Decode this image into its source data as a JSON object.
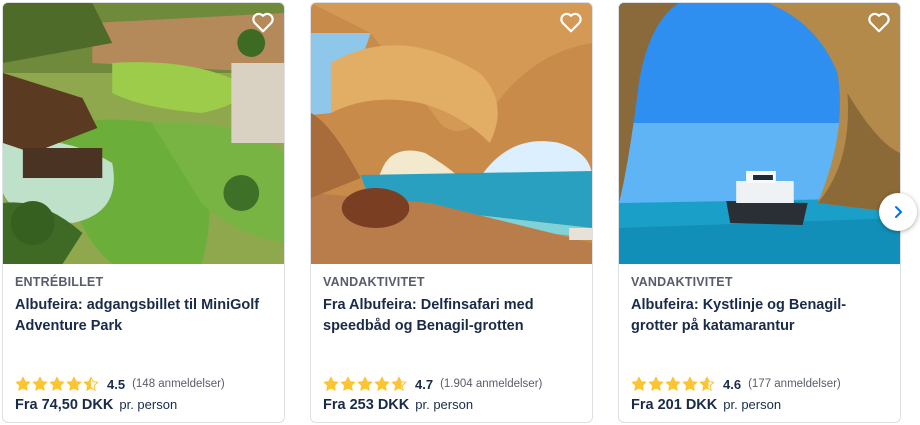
{
  "cards": [
    {
      "category": "ENTRÉBILLET",
      "title": "Albufeira: adgangsbillet til MiniGolf Adventure Park",
      "score": "4.5",
      "reviews": "(148 anmeldelser)",
      "rating_value": 4.5,
      "price_amount": "Fra 74,50 DKK",
      "price_unit": "pr. person"
    },
    {
      "category": "VANDAKTIVITET",
      "title": "Fra Albufeira: Delfinsafari med speedbåd og Benagil-grotten",
      "score": "4.7",
      "reviews": "(1.904 anmeldelser)",
      "rating_value": 4.7,
      "price_amount": "Fra 253 DKK",
      "price_unit": "pr. person"
    },
    {
      "category": "VANDAKTIVITET",
      "title": "Albufeira: Kystlinje og Benagil-grotter på katamarantur",
      "score": "4.6",
      "reviews": "(177 anmeldelser)",
      "rating_value": 4.6,
      "price_amount": "Fra 201 DKK",
      "price_unit": "pr. person"
    }
  ],
  "colors": {
    "star": "#fdc433",
    "text": "#1a2b49",
    "muted": "#585d6b",
    "border": "#dcdfe4"
  },
  "icons": {
    "favorite": "heart-outline-icon",
    "star": "star-icon",
    "next": "chevron-right-icon"
  }
}
